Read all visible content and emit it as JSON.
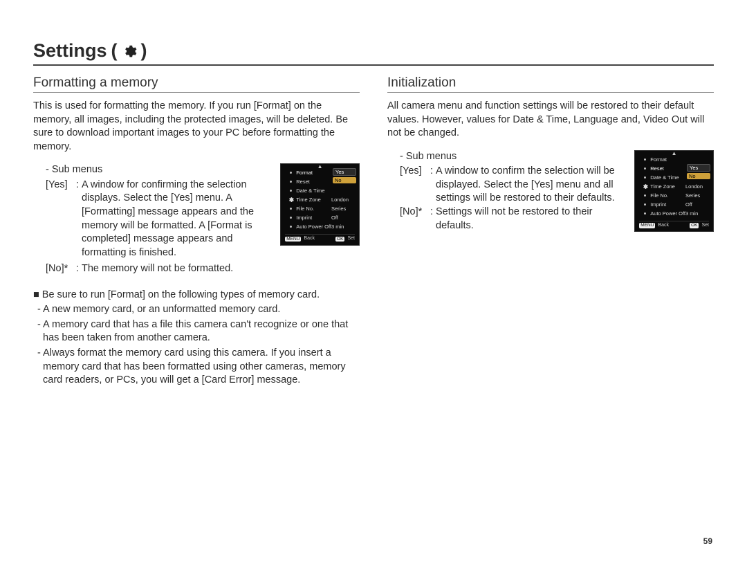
{
  "pageTitle": "Settings",
  "pageNumber": "59",
  "left": {
    "heading": "Formatting a memory",
    "intro": "This is used for formatting the memory. If you run [Format] on the memory, all images, including the protected images, will be deleted. Be sure to download important images to your PC before formatting the memory.",
    "subMenusLabel": "- Sub menus",
    "yesKey": "[Yes]",
    "yesColon": ":",
    "yesText": "A window for confirming the selection displays. Select the [Yes] menu. A [Formatting] message appears and the memory will be formatted. A [Format is completed] message appears and formatting is finished.",
    "noKey": "[No]*",
    "noColon": ":",
    "noText": "The memory will not be formatted.",
    "notesLead": "■ Be sure to run [Format] on the following types of memory card.",
    "note1": "- A new memory card, or an unformatted memory card.",
    "note2": "- A memory card that has a file this camera can't recognize or one that has been taken from another camera.",
    "note3": "- Always format the memory card using this camera. If you insert a memory card that has been formatted using other cameras, memory card readers, or PCs, you will get a [Card Error] message."
  },
  "right": {
    "heading": "Initialization",
    "intro": "All camera menu and function settings will be restored to their default values. However, values for Date & Time, Language and, Video Out will not be changed.",
    "subMenusLabel": "- Sub menus",
    "yesKey": "[Yes]",
    "yesColon": ":",
    "yesText": "A window to confirm the selection will be displayed. Select the [Yes] menu and all settings will be restored to their defaults.",
    "noKey": "[No]*",
    "noColon": ":",
    "noText": "Settings will not be restored to their defaults."
  },
  "lcd": {
    "selected": "Format",
    "pillYes": "Yes",
    "pillNo": "No",
    "rows": [
      {
        "label": "Format",
        "value": ""
      },
      {
        "label": "Reset",
        "value": ""
      },
      {
        "label": "Date & Time",
        "value": ""
      },
      {
        "label": "Time Zone",
        "value": "London"
      },
      {
        "label": "File No.",
        "value": "Series"
      },
      {
        "label": "Imprint",
        "value": "Off"
      },
      {
        "label": "Auto Power Off",
        "value": "3 min"
      }
    ],
    "footBackTag": "MENU",
    "footBack": "Back",
    "footSetTag": "OK",
    "footSet": "Set"
  },
  "lcd2": {
    "selected": "Reset",
    "pillYes": "Yes",
    "pillNo": "No",
    "rows": [
      {
        "label": "Format",
        "value": ""
      },
      {
        "label": "Reset",
        "value": ""
      },
      {
        "label": "Date & Time",
        "value": ""
      },
      {
        "label": "Time Zone",
        "value": "London"
      },
      {
        "label": "File No.",
        "value": "Series"
      },
      {
        "label": "Imprint",
        "value": "Off"
      },
      {
        "label": "Auto Power Off",
        "value": "3 min"
      }
    ],
    "footBackTag": "MENU",
    "footBack": "Back",
    "footSetTag": "OK",
    "footSet": "Set"
  }
}
